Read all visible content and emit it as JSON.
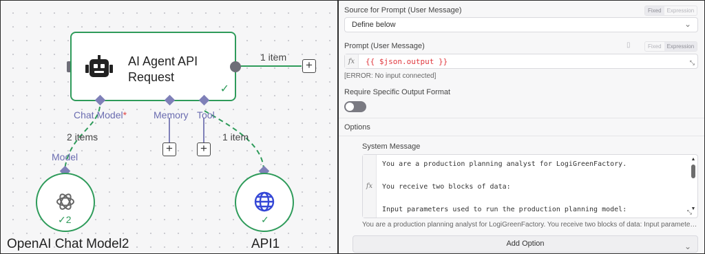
{
  "canvas": {
    "agent_node": {
      "title": "AI Agent API Request",
      "status": "success"
    },
    "output_edge": {
      "label": "1 item"
    },
    "ports": {
      "chat_model": {
        "label": "Chat Model",
        "required_mark": "*"
      },
      "memory": {
        "label": "Memory"
      },
      "tool": {
        "label": "Tool"
      }
    },
    "chat_model_edge": {
      "label": "2 items"
    },
    "tool_edge": {
      "label": "1 item"
    },
    "openai_node": {
      "port_label": "Model",
      "name": "OpenAI Chat Model2",
      "run_count": "2",
      "icon": "openai-icon"
    },
    "api_node": {
      "name": "API1",
      "icon": "globe-icon"
    },
    "colors": {
      "success": "#2e9b5a",
      "port": "#7f80b8",
      "edge": "#2e9b5a"
    }
  },
  "panel": {
    "source": {
      "label": "Source for Prompt (User Message)",
      "mode_fixed": "Fixed",
      "mode_expression": "Expression",
      "value": "Define below"
    },
    "prompt": {
      "label": "Prompt (User Message)",
      "mode_fixed": "Fixed",
      "mode_expression": "Expression",
      "fx": "fx",
      "expression": "{{ $json.output }}",
      "error": "[ERROR: No input connected]"
    },
    "output_format": {
      "label": "Require Specific Output Format",
      "enabled": false
    },
    "options": {
      "label": "Options",
      "system_message": {
        "label": "System Message",
        "fx": "fx",
        "lines": [
          "You are a production planning analyst for LogiGreenFactory.",
          "",
          "You receive two blocks of data:",
          "",
          "Input parameters used to run the production planning model:"
        ],
        "preview": "You are a production planning analyst for LogiGreenFactory. You receive two blocks of data: Input parameters used to run the production planning model:"
      },
      "add_option": "Add Option"
    }
  }
}
